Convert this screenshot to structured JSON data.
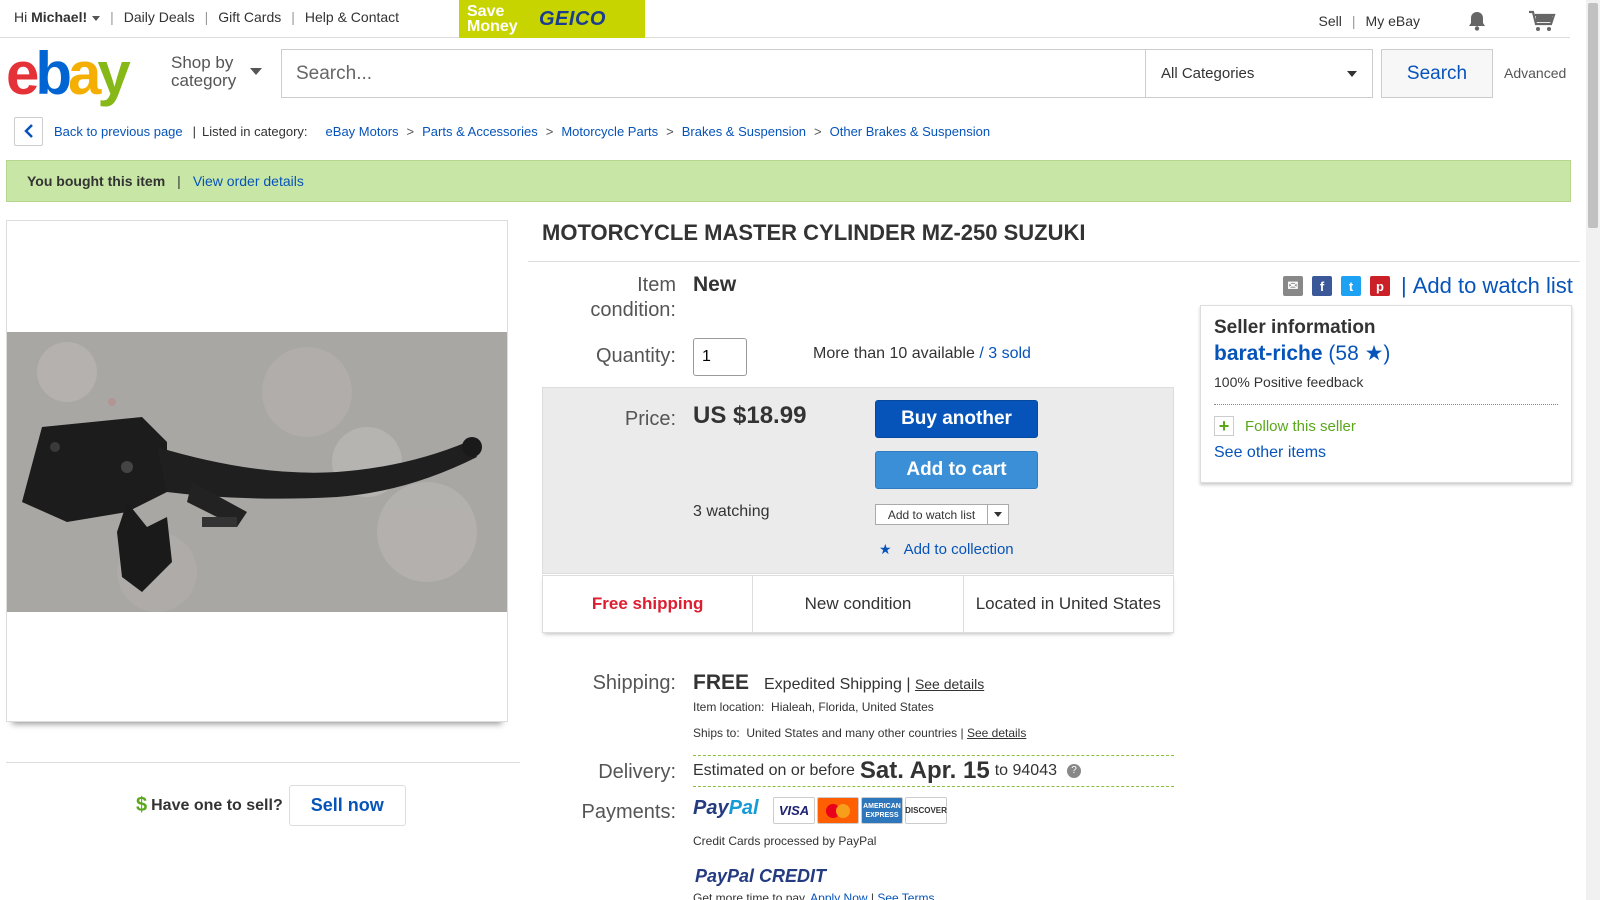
{
  "topbar": {
    "greeting_prefix": "Hi ",
    "user": "Michael!",
    "links": [
      "Daily Deals",
      "Gift Cards",
      "Help & Contact"
    ],
    "ad_save": "Save Money",
    "ad_brand": "GEICO",
    "sell": "Sell",
    "my_ebay": "My eBay"
  },
  "header": {
    "logo": {
      "e": "e",
      "b": "b",
      "a": "a",
      "y": "y"
    },
    "shop_by_1": "Shop by",
    "shop_by_2": "category",
    "search_placeholder": "Search...",
    "category": "All Categories",
    "search_button": "Search",
    "advanced": "Advanced"
  },
  "breadcrumb": {
    "back": "Back to previous page",
    "listed_in": "Listed in category:",
    "items": [
      "eBay Motors",
      "Parts & Accessories",
      "Motorcycle Parts",
      "Brakes & Suspension",
      "Other Brakes & Suspension"
    ]
  },
  "banner": {
    "bought": "You bought this item",
    "view_order": "View order details"
  },
  "item": {
    "title": "MOTORCYCLE MASTER CYLINDER MZ-250 SUZUKI",
    "condition_label_1": "Item",
    "condition_label_2": "condition:",
    "condition": "New",
    "quantity_label": "Quantity:",
    "quantity": "1",
    "available": "More than 10 available",
    "sold": "3 sold",
    "price_label": "Price:",
    "price": "US $18.99",
    "buy_another": "Buy another",
    "add_to_cart": "Add to cart",
    "watching": "3 watching",
    "add_watch": "Add to watch list",
    "add_collection": "Add to collection",
    "features": [
      "Free shipping",
      "New condition",
      "Located in United States"
    ]
  },
  "shipping": {
    "label": "Shipping:",
    "free": "FREE",
    "type": "Expedited Shipping |",
    "see_details": "See details",
    "location_label": "Item location:",
    "location": "Hialeah, Florida, United States",
    "ships_to_label": "Ships to:",
    "ships_to": "United States and many other countries |",
    "see_details_2": "See details"
  },
  "delivery": {
    "label": "Delivery:",
    "prefix": "Estimated on or before",
    "date": "Sat. Apr. 15",
    "suffix": "to 94043",
    "help": "?"
  },
  "payments": {
    "label": "Payments:",
    "paypal_1": "Pay",
    "paypal_2": "Pal",
    "cards": [
      "VISA",
      "MasterCard",
      "AMERICAN EXPRESS",
      "DISCOVER"
    ],
    "processed": "Credit Cards processed by PayPal",
    "credit": "PayPal CREDIT",
    "get_more": "Get more time to pay.",
    "apply": "Apply Now",
    "terms": "See Terms"
  },
  "seller": {
    "add_watch": "Add to watch list",
    "heading": "Seller information",
    "name": "barat-riche",
    "open_paren": "(",
    "feedback_score": "58",
    "close_paren": ")",
    "positive": "100% Positive feedback",
    "follow": "Follow this seller",
    "see_other": "See other items"
  },
  "sell_promo": {
    "question": "Have one to sell?",
    "button": "Sell now"
  },
  "colors": {
    "link": "#0654ba",
    "banner": "#c8e6a6",
    "buy_button": "#0654ba",
    "cart_button": "#3a8fd6",
    "free_shipping": "#dd1e31",
    "geico_ad": "#c8d400"
  }
}
